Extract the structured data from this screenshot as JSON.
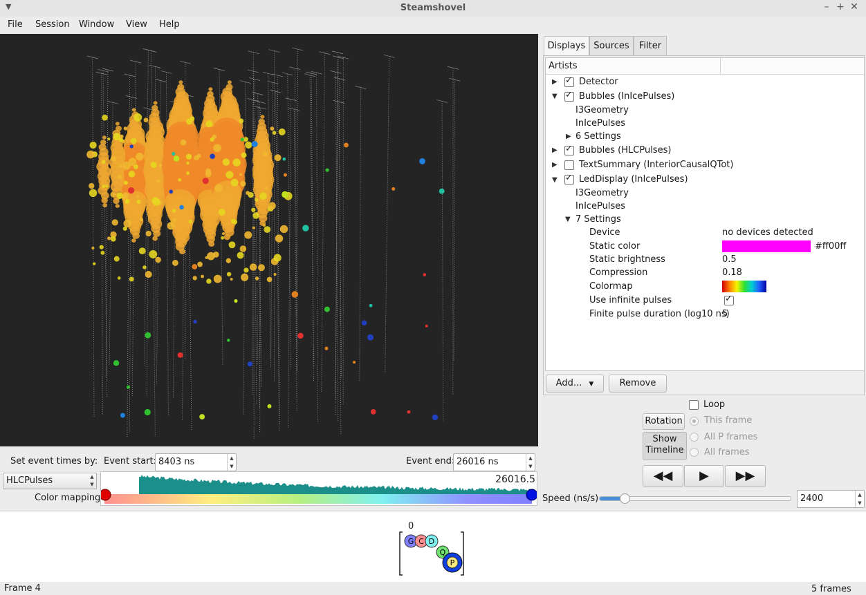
{
  "window": {
    "title": "Steamshovel"
  },
  "menu": [
    "File",
    "Session",
    "Window",
    "View",
    "Help"
  ],
  "tabs": [
    "Displays",
    "Sources",
    "Filter"
  ],
  "tree": {
    "header": "Artists",
    "items": [
      {
        "label": "Detector",
        "checked": true
      },
      {
        "label": "Bubbles (InIcePulses)",
        "checked": true
      },
      {
        "label": "I3Geometry"
      },
      {
        "label": "InIcePulses"
      },
      {
        "label": "6 Settings"
      },
      {
        "label": "Bubbles (HLCPulses)",
        "checked": true
      },
      {
        "label": "TextSummary (InteriorCausalQTot)",
        "checked": false
      },
      {
        "label": "LedDisplay (InIcePulses)",
        "checked": true
      },
      {
        "label": "I3Geometry"
      },
      {
        "label": "InIcePulses"
      },
      {
        "label": "7 Settings"
      }
    ],
    "settings": [
      {
        "key": "Device",
        "value": "no devices detected"
      },
      {
        "key": "Static color",
        "value": "#ff00ff"
      },
      {
        "key": "Static brightness",
        "value": "0.5"
      },
      {
        "key": "Compression",
        "value": "0.18"
      },
      {
        "key": "Colormap",
        "value": ""
      },
      {
        "key": "Use infinite pulses",
        "value": ""
      },
      {
        "key": "Finite pulse duration (log10 ns)",
        "value": "5"
      }
    ],
    "static_color": "#ff00ff"
  },
  "buttons": {
    "add": "Add...",
    "remove": "Remove",
    "rotation": "Rotation",
    "show_timeline_1": "Show",
    "show_timeline_2": "Timeline"
  },
  "playback": {
    "loop": "Loop",
    "radios": [
      "This frame",
      "All P frames",
      "All frames"
    ],
    "speed_label": "Speed (ns/s)",
    "speed_value": "2400",
    "speed_fraction": 0.13
  },
  "time_controls": {
    "set_by_label": "Set event times by:",
    "event_start_label": "Event start:",
    "event_start": "8403 ns",
    "event_end_label": "Event end:",
    "event_end": "26016 ns",
    "source_select": "HLCPulses",
    "color_mapping_label": "Color mapping:",
    "histogram_max": "26016.5"
  },
  "frame_diagram": {
    "index": "0",
    "nodes": [
      "G",
      "C",
      "D",
      "Q",
      "P"
    ]
  },
  "status": {
    "left": "Frame 4",
    "right": "5 frames"
  }
}
